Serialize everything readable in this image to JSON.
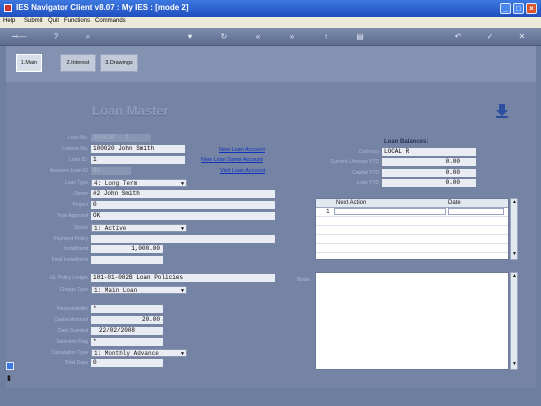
{
  "window": {
    "title": "IES Navigator Client v8.07 : My IES :     [mode 2]"
  },
  "menu": [
    "Help",
    "Submit",
    "Quit",
    "Functions",
    "Commands"
  ],
  "tabs": [
    {
      "label": "1.Main"
    },
    {
      "label": "2.Interest"
    },
    {
      "label": "3.Drawings"
    }
  ],
  "screen_title": "Loan Master",
  "form": {
    "loan_no": {
      "label": "Loan No.",
      "value": "100020 - 1"
    },
    "loanee": {
      "label": "Loanee No.",
      "value": "100020 John Smith"
    },
    "loan_id": {
      "label": "Loan ID.",
      "value": "1"
    },
    "answers_loan": {
      "label": "Answers Loan ID",
      "value": "No"
    },
    "loan_type": {
      "label": "Loan Type",
      "value": "4: Long Term"
    },
    "owner": {
      "label": "Owner",
      "value": "#2 John Smith"
    },
    "project": {
      "label": "Project",
      "value": "0"
    },
    "year_approval": {
      "label": "Year Approval",
      "value": "OK"
    },
    "status": {
      "label": "Status",
      "value": "1: Active"
    },
    "payment_policy": {
      "label": "Payment Policy",
      "value": ""
    },
    "installment": {
      "label": "Installment",
      "value": "1,000.00"
    },
    "final_installment": {
      "label": "Final Installment",
      "value": ""
    },
    "gl_policy_ledger": {
      "label": "GL Policy Ledger",
      "value": "101-01-002B Loan Policies"
    },
    "charge_type": {
      "label": "Charge Type",
      "value": "1: Main Loan"
    },
    "responsibility": {
      "label": "Responsibility",
      "value": "*"
    },
    "capital_amount": {
      "label": "Capital Amount",
      "value": "20.00"
    },
    "date_granted": {
      "label": "Date Granted",
      "value": "22/02/2008"
    },
    "selection_flag": {
      "label": "Selection Flag",
      "value": "*"
    },
    "calculation_type": {
      "label": "Calculation Type",
      "value": "1: Monthly Advance"
    },
    "total_days": {
      "label": "Total Days",
      "value": "0"
    }
  },
  "links": {
    "new_loan_account": "New Loan Account",
    "new_loan_same_account": "New Loan Same Account",
    "visit_loan_account": "Visit Loan Account"
  },
  "balances": {
    "heading": "Loan Balances:",
    "currency": {
      "label": "Currency",
      "value": "LOCAL R"
    },
    "current_arrears": {
      "label": "Current / Arrears YTD",
      "value": "0.00"
    },
    "capital_ytd": {
      "label": "Capital YTD",
      "value": "0.00"
    },
    "loan_ytd": {
      "label": "Loan YTD",
      "value": "0.00"
    }
  },
  "action_grid": {
    "columns": [
      "Next Action",
      "Date"
    ],
    "rows": [
      {
        "num": "1",
        "action": "",
        "date": ""
      }
    ]
  },
  "notes": {
    "label": "Notes"
  },
  "colors": {
    "title_bar": "#2a5fd0",
    "background": "#7584a5",
    "field": "#e9ecf2"
  }
}
